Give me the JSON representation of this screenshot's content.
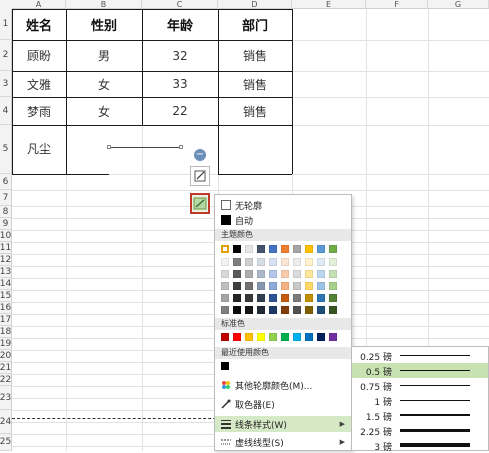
{
  "columns": [
    "A",
    "B",
    "C",
    "D",
    "E",
    "F",
    "G"
  ],
  "rows": [
    "1",
    "2",
    "3",
    "4",
    "5",
    "6",
    "7",
    "8",
    "9",
    "10",
    "11",
    "12",
    "13",
    "14",
    "15",
    "16",
    "17",
    "18",
    "19",
    "20",
    "21",
    "22",
    "23",
    "24",
    "25"
  ],
  "table": {
    "headers": [
      "姓名",
      "性别",
      "年龄",
      "部门"
    ],
    "rows": [
      [
        "顾盼",
        "男",
        "32",
        "销售"
      ],
      [
        "文雅",
        "女",
        "33",
        "销售"
      ],
      [
        "梦雨",
        "女",
        "22",
        "销售"
      ],
      [
        "凡尘",
        "",
        "",
        ""
      ]
    ]
  },
  "menu": {
    "no_outline": "无轮廓",
    "auto": "自动",
    "theme_colors": "主题颜色",
    "standard_colors": "标准色",
    "recent_colors": "最近使用颜色",
    "more_colors": "其他轮廓颜色(M)...",
    "eyedropper": "取色器(E)",
    "line_style": "线条样式(W)",
    "dash_type": "虚线线型(S)"
  },
  "theme_top": [
    "#ffffff",
    "#000000",
    "#e7e6e6",
    "#44546a",
    "#4472c4",
    "#ed7d31",
    "#a5a5a5",
    "#ffc000",
    "#5b9bd5",
    "#70ad47"
  ],
  "theme_shades": [
    [
      "#f2f2f2",
      "#7f7f7f",
      "#d0cece",
      "#d6dce4",
      "#d9e2f3",
      "#fbe5d5",
      "#ededed",
      "#fff2cc",
      "#deebf6",
      "#e2efd9"
    ],
    [
      "#d8d8d8",
      "#595959",
      "#aeabab",
      "#adb9ca",
      "#b4c6e7",
      "#f7cbac",
      "#dbdbdb",
      "#fee599",
      "#bdd7ee",
      "#c5e0b3"
    ],
    [
      "#bfbfbf",
      "#3f3f3f",
      "#757070",
      "#8496b0",
      "#8eaadb",
      "#f4b183",
      "#c9c9c9",
      "#ffd965",
      "#9cc3e5",
      "#a8d08d"
    ],
    [
      "#a5a5a5",
      "#262626",
      "#3a3838",
      "#323f4f",
      "#2f5496",
      "#c55a11",
      "#7b7b7b",
      "#bf9000",
      "#2e75b5",
      "#538135"
    ],
    [
      "#7f7f7f",
      "#0c0c0c",
      "#171616",
      "#222a35",
      "#1f3864",
      "#833c0b",
      "#525252",
      "#7f6000",
      "#1e4e79",
      "#375623"
    ]
  ],
  "standard": [
    "#c00000",
    "#ff0000",
    "#ffc000",
    "#ffff00",
    "#92d050",
    "#00b050",
    "#00b0f0",
    "#0070c0",
    "#002060",
    "#7030a0"
  ],
  "recent": [
    "#000000"
  ],
  "line_widths": [
    "0.25 磅",
    "0.5 磅",
    "0.75 磅",
    "1 磅",
    "1.5 磅",
    "2.25 磅",
    "3 磅"
  ],
  "line_width_values": [
    0.25,
    0.5,
    0.75,
    1,
    1.5,
    2.25,
    3
  ],
  "selected_line_width": "0.5 磅"
}
